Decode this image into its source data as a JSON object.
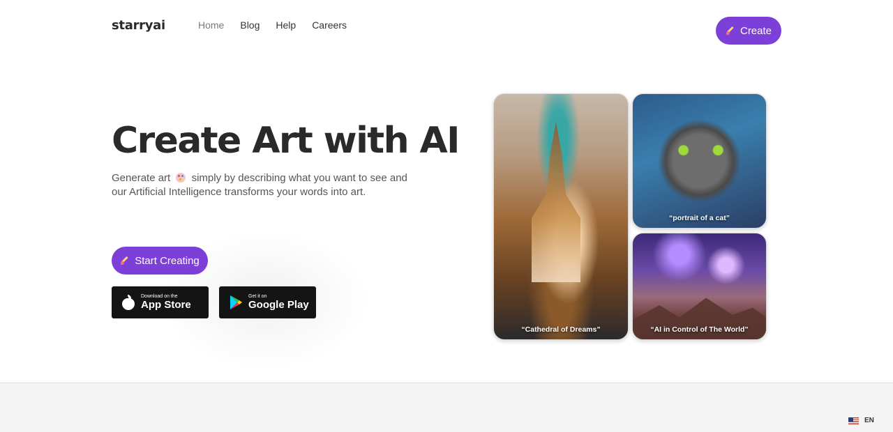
{
  "header": {
    "logo": "starryai",
    "nav": [
      {
        "label": "Home"
      },
      {
        "label": "Blog"
      },
      {
        "label": "Help"
      },
      {
        "label": "Careers"
      }
    ],
    "create_label": "Create"
  },
  "hero": {
    "title": "Create Art with AI",
    "subtitle_part1": "Generate art",
    "subtitle_part2": "simply by describing what you want to see and our Artificial Intelligence transforms your words into art.",
    "start_label": "Start Creating",
    "app_store": {
      "small": "Download on the",
      "big": "App Store"
    },
    "google_play": {
      "small": "Get it on",
      "big": "Google Play"
    }
  },
  "gallery": [
    {
      "caption": "“Cathedral of Dreams”"
    },
    {
      "caption": "“portrait of a cat”"
    },
    {
      "caption": "“AI in Control of The World”"
    }
  ],
  "footer": {
    "language": "EN"
  },
  "colors": {
    "accent": "#7c3fd7",
    "store_badge": "#141414",
    "footer_bg": "#f4f4f4"
  },
  "icons": {
    "create": "paintbrush-icon",
    "apple": "apple-icon",
    "google_play": "google-play-icon",
    "palette": "palette-emoji-icon",
    "flag": "us-flag-icon"
  }
}
